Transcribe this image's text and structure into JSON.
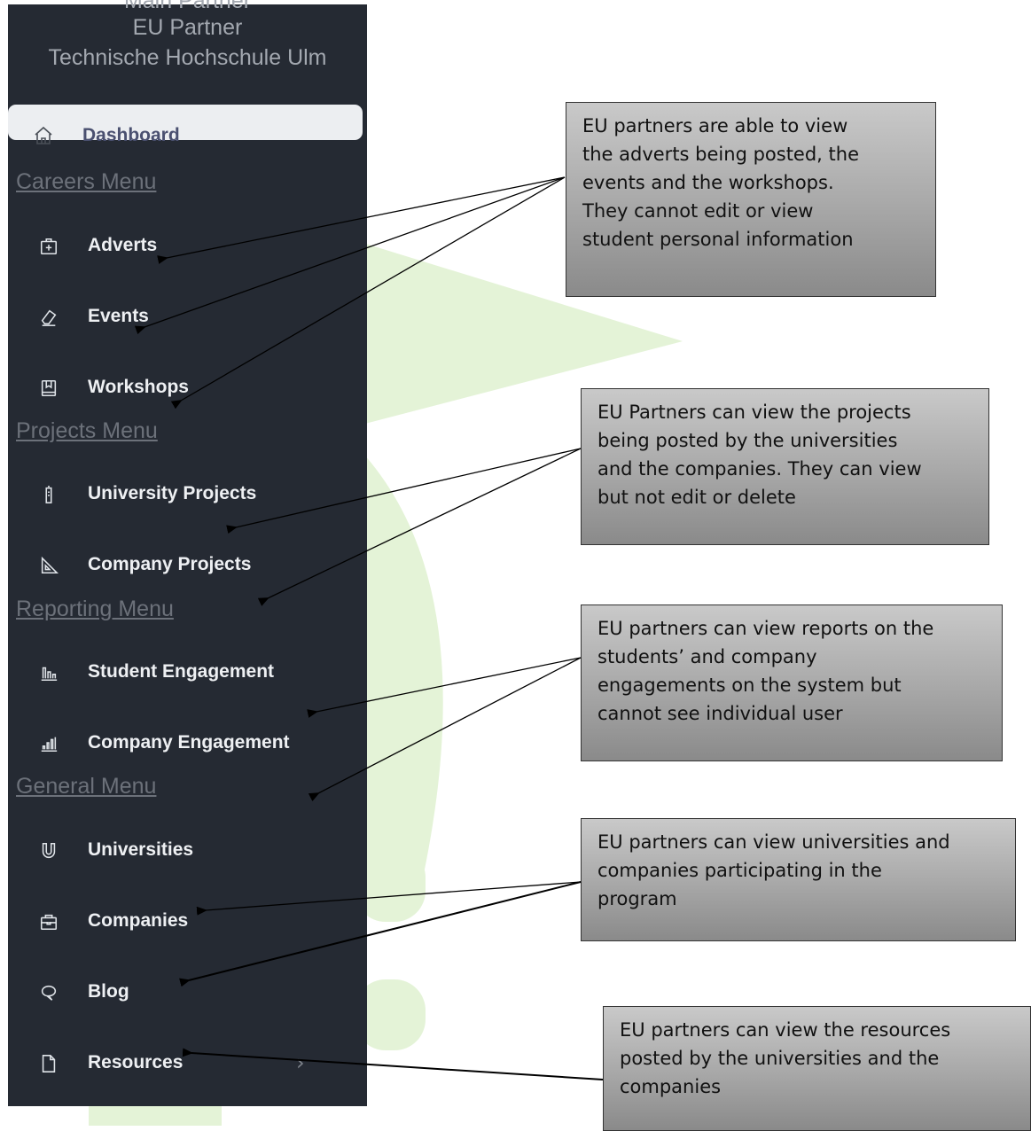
{
  "sidebar": {
    "profile": {
      "name": "Main Partner",
      "role": "EU Partner",
      "organization": "Technische Hochschule Ulm"
    },
    "dashboard": {
      "label": "Dashboard",
      "icon": "home-icon"
    },
    "sections": {
      "careers": "Careers Menu",
      "projects": "Projects Menu",
      "reporting": "Reporting Menu",
      "general": "General Menu"
    },
    "items": {
      "adverts": {
        "label": "Adverts",
        "icon": "add-box-icon"
      },
      "events": {
        "label": "Events",
        "icon": "eraser-icon"
      },
      "workshops": {
        "label": "Workshops",
        "icon": "book-icon"
      },
      "university_projects": {
        "label": "University Projects",
        "icon": "battery-icon"
      },
      "company_projects": {
        "label": "Company Projects",
        "icon": "set-square-icon"
      },
      "student_engagement": {
        "label": "Student Engagement",
        "icon": "bar-chart-icon"
      },
      "company_engagement": {
        "label": "Company Engagement",
        "icon": "signal-chart-icon"
      },
      "universities": {
        "label": "Universities",
        "icon": "magnet-icon"
      },
      "companies": {
        "label": "Companies",
        "icon": "briefcase-icon"
      },
      "blog": {
        "label": "Blog",
        "icon": "chat-icon"
      },
      "resources": {
        "label": "Resources",
        "icon": "file-icon",
        "chevron": "›"
      }
    }
  },
  "callouts": {
    "careers": [
      "EU partners are able to view",
      "the adverts being posted, the",
      "events and the workshops.",
      "They cannot edit or view",
      "student personal information"
    ],
    "projects": [
      "EU Partners can view the projects",
      "being posted by the universities",
      "and the companies. They can view",
      "but not edit or delete"
    ],
    "reporting": [
      "EU partners can view reports on the",
      "students’ and company",
      "engagements on the system but",
      "cannot see individual user"
    ],
    "general": [
      "EU partners can view universities and",
      "companies participating in the",
      "program"
    ],
    "resources": [
      "EU partners can view the resources",
      "posted by the universities and the",
      "companies"
    ]
  },
  "colors": {
    "sidebar_bg": "#252a33",
    "watermark_green": "#e3f2d6",
    "callout_border": "#333333"
  }
}
